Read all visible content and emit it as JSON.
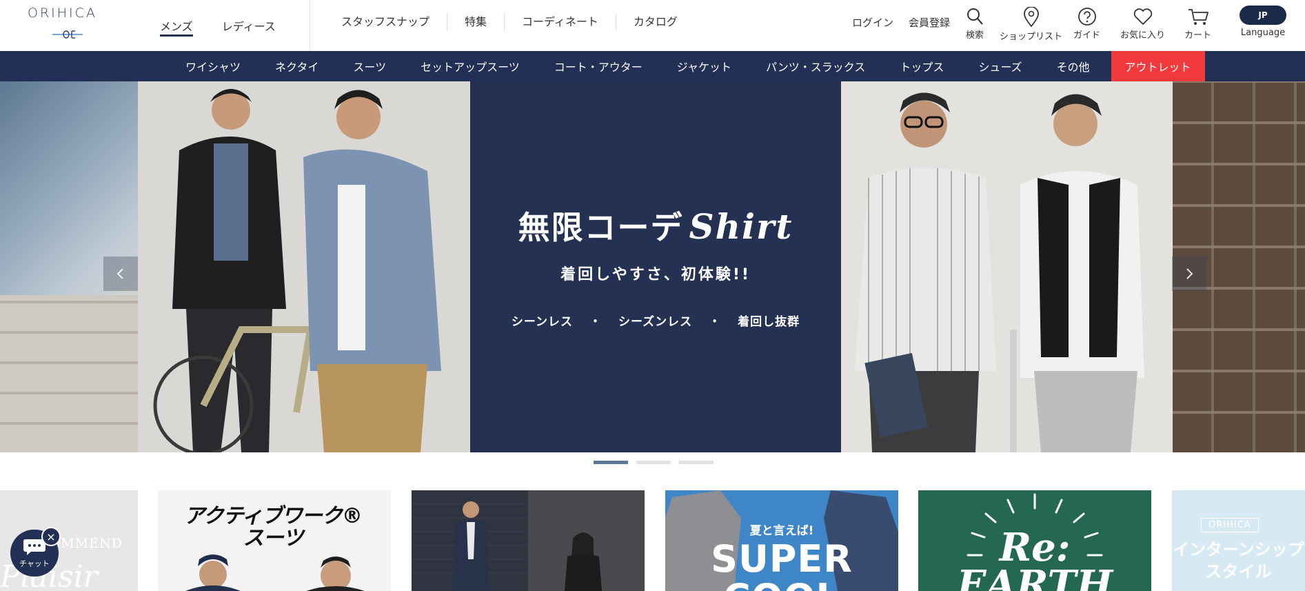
{
  "brand": {
    "logo_text": "ORIHICA"
  },
  "gender_tabs": [
    {
      "label": "メンズ",
      "active": true
    },
    {
      "label": "レディース",
      "active": false
    }
  ],
  "main_nav": [
    "スタッフスナップ",
    "特集",
    "コーディネート",
    "カタログ"
  ],
  "util_links": {
    "login": "ログイン",
    "register": "会員登録"
  },
  "icons": [
    {
      "name": "search-icon",
      "label": "検索"
    },
    {
      "name": "location-pin-icon",
      "label": "ショップリスト"
    },
    {
      "name": "help-circle-icon",
      "label": "ガイド"
    },
    {
      "name": "heart-icon",
      "label": "お気に入り"
    },
    {
      "name": "cart-icon",
      "label": "カート"
    }
  ],
  "language": {
    "code": "JP",
    "label": "Language"
  },
  "categories": [
    "ワイシャツ",
    "ネクタイ",
    "スーツ",
    "セットアップスーツ",
    "コート・アウター",
    "ジャケット",
    "パンツ・スラックス",
    "トップス",
    "シューズ",
    "その他",
    "アウトレット"
  ],
  "hero": {
    "title": "無限コーデ",
    "title_script": "Shirt",
    "subtitle": "着回しやすさ、初体験!!",
    "tags": [
      "シーンレス",
      "シーズンレス",
      "着回し抜群"
    ],
    "tag_separator": "・"
  },
  "carousel": {
    "slides": 3,
    "active_index": 0
  },
  "banners": {
    "b0_text": "RECOMMEND",
    "b1_title": "アクティブワーク® スーツ",
    "b3_small": "夏と言えば!",
    "b3_big": "SUPER COOL",
    "b4_text": "Re: EARTH",
    "b5_badge": "ORIHICA",
    "b5_text": "インターンシップ スタイル"
  },
  "chat": {
    "label": "チャット",
    "close": "×"
  },
  "colors": {
    "navy": "#233055",
    "outlet_red": "#f2393c",
    "accent_blue": "#5a7897"
  }
}
